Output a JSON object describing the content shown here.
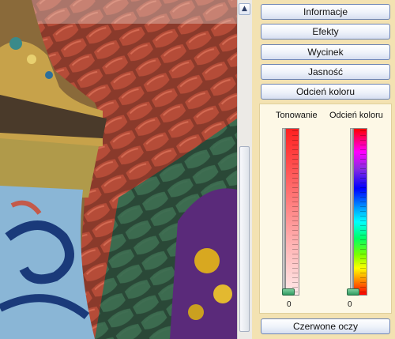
{
  "panel": {
    "buttons": {
      "informacje": "Informacje",
      "efekty": "Efekty",
      "wycinek": "Wycinek",
      "jasnosc": "Jasność",
      "odcien": "Odcień koloru",
      "czerwone_oczy": "Czerwone oczy"
    },
    "sliders": {
      "tonowanie": {
        "label": "Tonowanie",
        "value": "0"
      },
      "odcien": {
        "label": "Odcień koloru",
        "value": "0"
      }
    }
  },
  "scrollbar": {
    "up_glyph": "▲"
  },
  "colors": {
    "panel_bg": "#f3e2b2",
    "button_border": "#6d84b3",
    "slider_handle": "#2f9a60"
  }
}
